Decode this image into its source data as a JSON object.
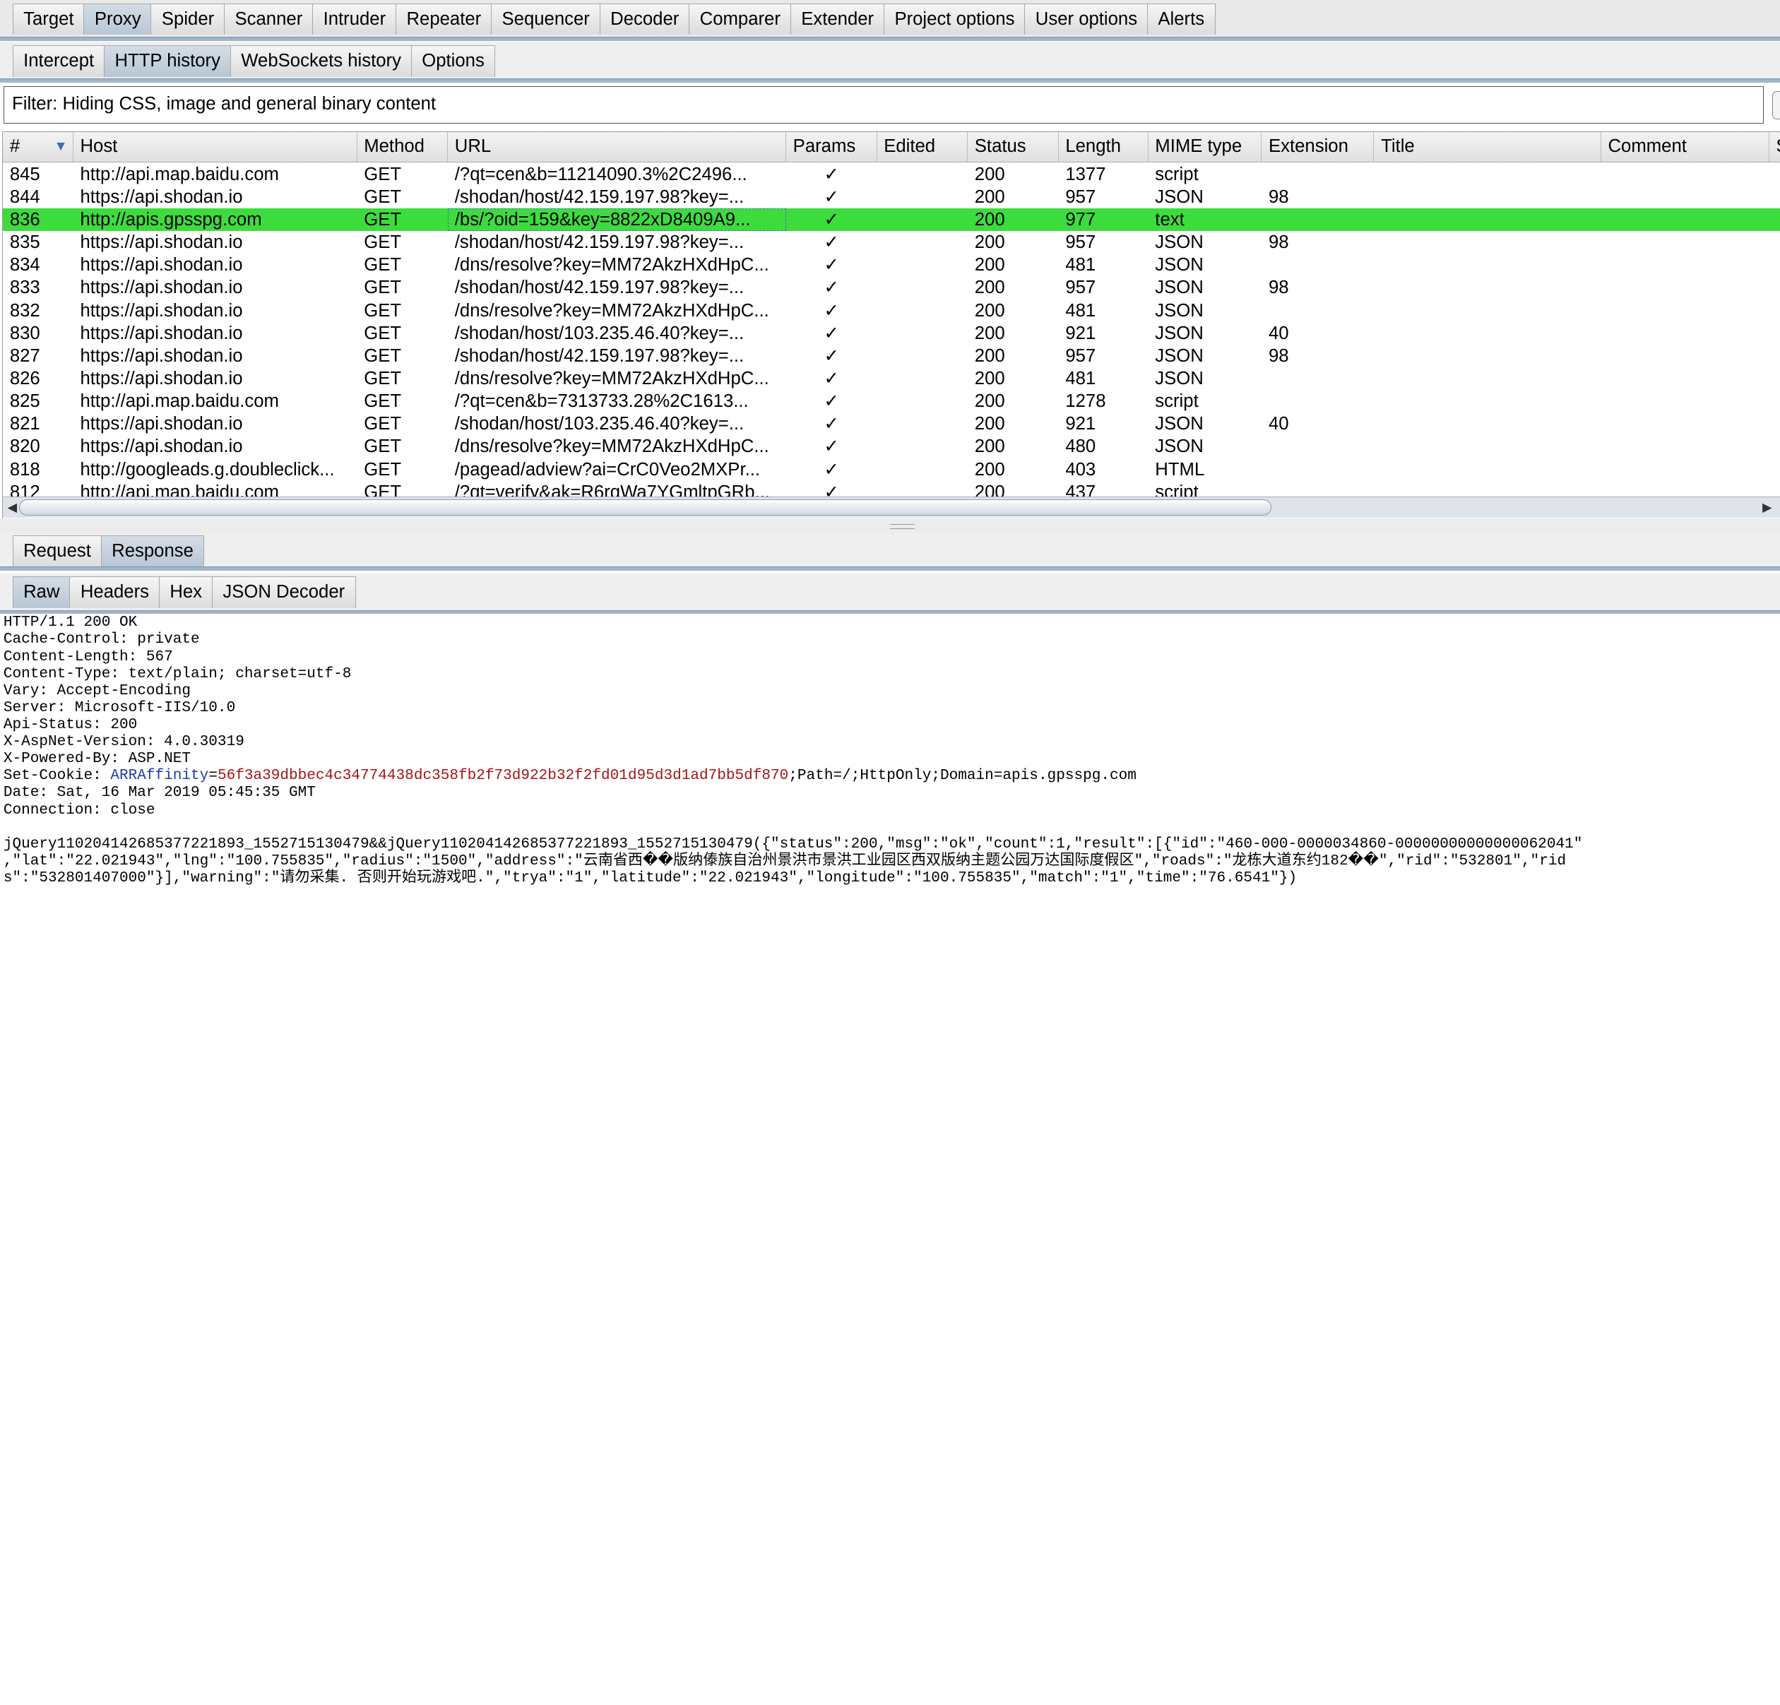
{
  "main_tabs": [
    "Target",
    "Proxy",
    "Spider",
    "Scanner",
    "Intruder",
    "Repeater",
    "Sequencer",
    "Decoder",
    "Comparer",
    "Extender",
    "Project options",
    "User options",
    "Alerts"
  ],
  "main_active": "Proxy",
  "proxy_tabs": [
    "Intercept",
    "HTTP history",
    "WebSockets history",
    "Options"
  ],
  "proxy_active": "HTTP history",
  "filter_text": "Filter: Hiding CSS, image and general binary content",
  "columns": [
    "#",
    "Host",
    "Method",
    "URL",
    "Params",
    "Edited",
    "Status",
    "Length",
    "MIME type",
    "Extension",
    "Title",
    "Comment",
    "S"
  ],
  "sort_icon": "sort-desc-icon",
  "check_glyph": "✓",
  "selected_row": "836",
  "rows": [
    {
      "num": "845",
      "host": "http://api.map.baidu.com",
      "method": "GET",
      "url": "/?qt=cen&b=11214090.3%2C2496...",
      "params": true,
      "status": "200",
      "length": "1377",
      "mime": "script",
      "ext": ""
    },
    {
      "num": "844",
      "host": "https://api.shodan.io",
      "method": "GET",
      "url": "/shodan/host/42.159.197.98?key=...",
      "params": true,
      "status": "200",
      "length": "957",
      "mime": "JSON",
      "ext": "98"
    },
    {
      "num": "836",
      "host": "http://apis.gpsspg.com",
      "method": "GET",
      "url": "/bs/?oid=159&key=8822xD8409A9...",
      "params": true,
      "status": "200",
      "length": "977",
      "mime": "text",
      "ext": ""
    },
    {
      "num": "835",
      "host": "https://api.shodan.io",
      "method": "GET",
      "url": "/shodan/host/42.159.197.98?key=...",
      "params": true,
      "status": "200",
      "length": "957",
      "mime": "JSON",
      "ext": "98"
    },
    {
      "num": "834",
      "host": "https://api.shodan.io",
      "method": "GET",
      "url": "/dns/resolve?key=MM72AkzHXdHpC...",
      "params": true,
      "status": "200",
      "length": "481",
      "mime": "JSON",
      "ext": ""
    },
    {
      "num": "833",
      "host": "https://api.shodan.io",
      "method": "GET",
      "url": "/shodan/host/42.159.197.98?key=...",
      "params": true,
      "status": "200",
      "length": "957",
      "mime": "JSON",
      "ext": "98"
    },
    {
      "num": "832",
      "host": "https://api.shodan.io",
      "method": "GET",
      "url": "/dns/resolve?key=MM72AkzHXdHpC...",
      "params": true,
      "status": "200",
      "length": "481",
      "mime": "JSON",
      "ext": ""
    },
    {
      "num": "830",
      "host": "https://api.shodan.io",
      "method": "GET",
      "url": "/shodan/host/103.235.46.40?key=...",
      "params": true,
      "status": "200",
      "length": "921",
      "mime": "JSON",
      "ext": "40"
    },
    {
      "num": "827",
      "host": "https://api.shodan.io",
      "method": "GET",
      "url": "/shodan/host/42.159.197.98?key=...",
      "params": true,
      "status": "200",
      "length": "957",
      "mime": "JSON",
      "ext": "98"
    },
    {
      "num": "826",
      "host": "https://api.shodan.io",
      "method": "GET",
      "url": "/dns/resolve?key=MM72AkzHXdHpC...",
      "params": true,
      "status": "200",
      "length": "481",
      "mime": "JSON",
      "ext": ""
    },
    {
      "num": "825",
      "host": "http://api.map.baidu.com",
      "method": "GET",
      "url": "/?qt=cen&b=7313733.28%2C1613...",
      "params": true,
      "status": "200",
      "length": "1278",
      "mime": "script",
      "ext": ""
    },
    {
      "num": "821",
      "host": "https://api.shodan.io",
      "method": "GET",
      "url": "/shodan/host/103.235.46.40?key=...",
      "params": true,
      "status": "200",
      "length": "921",
      "mime": "JSON",
      "ext": "40"
    },
    {
      "num": "820",
      "host": "https://api.shodan.io",
      "method": "GET",
      "url": "/dns/resolve?key=MM72AkzHXdHpC...",
      "params": true,
      "status": "200",
      "length": "480",
      "mime": "JSON",
      "ext": ""
    },
    {
      "num": "818",
      "host": "http://googleads.g.doubleclick...",
      "method": "GET",
      "url": "/pagead/adview?ai=CrC0Veo2MXPr...",
      "params": true,
      "status": "200",
      "length": "403",
      "mime": "HTML",
      "ext": ""
    },
    {
      "num": "812",
      "host": "http://api.map.baidu.com",
      "method": "GET",
      "url": "/?qt=verify&ak=R6rqWa7YGmltpGRb...",
      "params": true,
      "status": "200",
      "length": "437",
      "mime": "script",
      "ext": ""
    }
  ],
  "reqres_tabs": [
    "Request",
    "Response"
  ],
  "reqres_active": "Response",
  "view_tabs": [
    "Raw",
    "Headers",
    "Hex",
    "JSON Decoder"
  ],
  "view_active": "Raw",
  "response": {
    "headers_before_cookie": [
      "HTTP/1.1 200 OK",
      "Cache-Control: private",
      "Content-Length: 567",
      "Content-Type: text/plain; charset=utf-8",
      "Vary: Accept-Encoding",
      "Server: Microsoft-IIS/10.0",
      "Api-Status: 200",
      "X-AspNet-Version: 4.0.30319",
      "X-Powered-By: ASP.NET"
    ],
    "cookie_prefix": "Set-Cookie: ",
    "cookie_name": "ARRAffinity",
    "cookie_eq": "=",
    "cookie_value": "56f3a39dbbec4c34774438dc358fb2f73d922b32f2fd01d95d3d1ad7bb5df870",
    "cookie_rest": ";Path=/;HttpOnly;Domain=apis.gpsspg.com",
    "headers_after_cookie": [
      "Date: Sat, 16 Mar 2019 05:45:35 GMT",
      "Connection: close"
    ],
    "body_lines": [
      "jQuery110204142685377221893_1552715130479&&jQuery110204142685377221893_1552715130479({\"status\":200,\"msg\":\"ok\",\"count\":1,\"result\":[{\"id\":\"460-000-0000034860-00000000000000062041\"",
      ",\"lat\":\"22.021943\",\"lng\":\"100.755835\",\"radius\":\"1500\",\"address\":\"云南省西��版纳傣族自治州景洪市景洪工业园区西双版纳主题公园万达国际度假区\",\"roads\":\"龙栋大道东约182��\",\"rid\":\"532801\",\"rid",
      "s\":\"532801407000\"}],\"warning\":\"请勿采集. 否则开始玩游戏吧.\",\"trya\":\"1\",\"latitude\":\"22.021943\",\"longitude\":\"100.755835\",\"match\":\"1\",\"time\":\"76.6541\"})"
    ]
  }
}
